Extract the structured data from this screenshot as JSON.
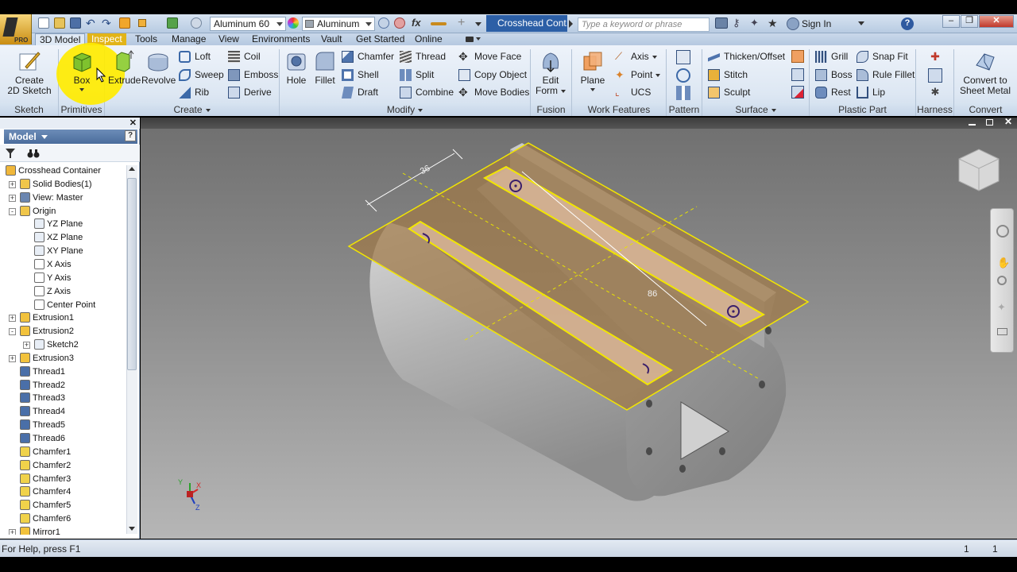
{
  "app": {
    "edition_badge": "PRO",
    "document_title": "Crosshead Cont...",
    "search_placeholder": "Type a keyword or phrase",
    "sign_in": "Sign In",
    "material_combo": "Aluminum 60",
    "appearance_combo": "Aluminum",
    "formula_label": "fx"
  },
  "tabs": [
    {
      "label": "3D Model",
      "active": true
    },
    {
      "label": "Inspect",
      "highlight": true
    },
    {
      "label": "Tools"
    },
    {
      "label": "Manage"
    },
    {
      "label": "View"
    },
    {
      "label": "Environments"
    },
    {
      "label": "Vault"
    },
    {
      "label": "Get Started"
    },
    {
      "label": "Online"
    }
  ],
  "ribbon": {
    "sketch": {
      "label": "Sketch",
      "create_2d_sketch": [
        "Create",
        "2D Sketch"
      ]
    },
    "primitives": {
      "label": "Primitives",
      "box": "Box"
    },
    "create": {
      "label": "Create",
      "extrude": "Extrude",
      "revolve": "Revolve",
      "loft": "Loft",
      "sweep": "Sweep",
      "rib": "Rib",
      "coil": "Coil",
      "emboss": "Emboss",
      "derive": "Derive"
    },
    "modify": {
      "label": "Modify",
      "hole": "Hole",
      "fillet": "Fillet",
      "chamfer": "Chamfer",
      "shell": "Shell",
      "draft": "Draft",
      "thread": "Thread",
      "split": "Split",
      "combine": "Combine",
      "move_face": "Move Face",
      "copy_object": "Copy Object",
      "move_bodies": "Move Bodies"
    },
    "fusion": {
      "label": "Fusion",
      "edit_form": [
        "Edit",
        "Form"
      ]
    },
    "work_features": {
      "label": "Work Features",
      "plane": "Plane",
      "axis": "Axis",
      "point": "Point",
      "ucs": "UCS"
    },
    "pattern": {
      "label": "Pattern"
    },
    "surface": {
      "label": "Surface",
      "thicken_offset": "Thicken/Offset",
      "stitch": "Stitch",
      "sculpt": "Sculpt"
    },
    "plastic_part": {
      "label": "Plastic Part",
      "grill": "Grill",
      "boss": "Boss",
      "rest": "Rest",
      "snap_fit": "Snap Fit",
      "rule_fillet": "Rule Fillet",
      "lip": "Lip"
    },
    "harness": {
      "label": "Harness"
    },
    "convert": {
      "label": "Convert",
      "convert_to_sheet_metal": [
        "Convert to",
        "Sheet Metal"
      ]
    }
  },
  "browser": {
    "title": "Model",
    "help": "?",
    "tree": [
      {
        "label": "Crosshead Container",
        "depth": 0,
        "expander": "-",
        "icon": "part"
      },
      {
        "label": "Solid Bodies(1)",
        "depth": 1,
        "expander": "+",
        "icon": "folder"
      },
      {
        "label": "View: Master",
        "depth": 1,
        "expander": "+",
        "icon": "view"
      },
      {
        "label": "Origin",
        "depth": 1,
        "expander": "-",
        "icon": "folder"
      },
      {
        "label": "YZ Plane",
        "depth": 2,
        "icon": "plane"
      },
      {
        "label": "XZ Plane",
        "depth": 2,
        "icon": "plane"
      },
      {
        "label": "XY Plane",
        "depth": 2,
        "icon": "plane"
      },
      {
        "label": "X Axis",
        "depth": 2,
        "icon": "axis"
      },
      {
        "label": "Y Axis",
        "depth": 2,
        "icon": "axis"
      },
      {
        "label": "Z Axis",
        "depth": 2,
        "icon": "axis"
      },
      {
        "label": "Center Point",
        "depth": 2,
        "icon": "point"
      },
      {
        "label": "Extrusion1",
        "depth": 1,
        "expander": "+",
        "icon": "extrude"
      },
      {
        "label": "Extrusion2",
        "depth": 1,
        "expander": "-",
        "icon": "extrude"
      },
      {
        "label": "Sketch2",
        "depth": 2,
        "expander": "+",
        "icon": "sketch"
      },
      {
        "label": "Extrusion3",
        "depth": 1,
        "expander": "+",
        "icon": "extrude"
      },
      {
        "label": "Thread1",
        "depth": 1,
        "icon": "thread"
      },
      {
        "label": "Thread2",
        "depth": 1,
        "icon": "thread"
      },
      {
        "label": "Thread3",
        "depth": 1,
        "icon": "thread"
      },
      {
        "label": "Thread4",
        "depth": 1,
        "icon": "thread"
      },
      {
        "label": "Thread5",
        "depth": 1,
        "icon": "thread"
      },
      {
        "label": "Thread6",
        "depth": 1,
        "icon": "thread"
      },
      {
        "label": "Chamfer1",
        "depth": 1,
        "icon": "chamfer"
      },
      {
        "label": "Chamfer2",
        "depth": 1,
        "icon": "chamfer"
      },
      {
        "label": "Chamfer3",
        "depth": 1,
        "icon": "chamfer"
      },
      {
        "label": "Chamfer4",
        "depth": 1,
        "icon": "chamfer"
      },
      {
        "label": "Chamfer5",
        "depth": 1,
        "icon": "chamfer"
      },
      {
        "label": "Chamfer6",
        "depth": 1,
        "icon": "chamfer"
      },
      {
        "label": "Mirror1",
        "depth": 1,
        "expander": "+",
        "icon": "mirror"
      }
    ]
  },
  "viewport": {
    "dimension_36": "36",
    "dimension_86": "86",
    "triad": {
      "x": "X",
      "y": "Y",
      "z": "Z"
    }
  },
  "status": {
    "help_text": "For Help, press F1",
    "count_a": "1",
    "count_b": "1"
  },
  "colors": {
    "ribbon_bg": "#dde7f3",
    "accent_blue": "#2c5fa6",
    "highlight_yellow": "#f4e300",
    "selection_yellow": "#f2e600",
    "part_gray": "#a6a6a6",
    "sketch_face": "#a07a52"
  }
}
